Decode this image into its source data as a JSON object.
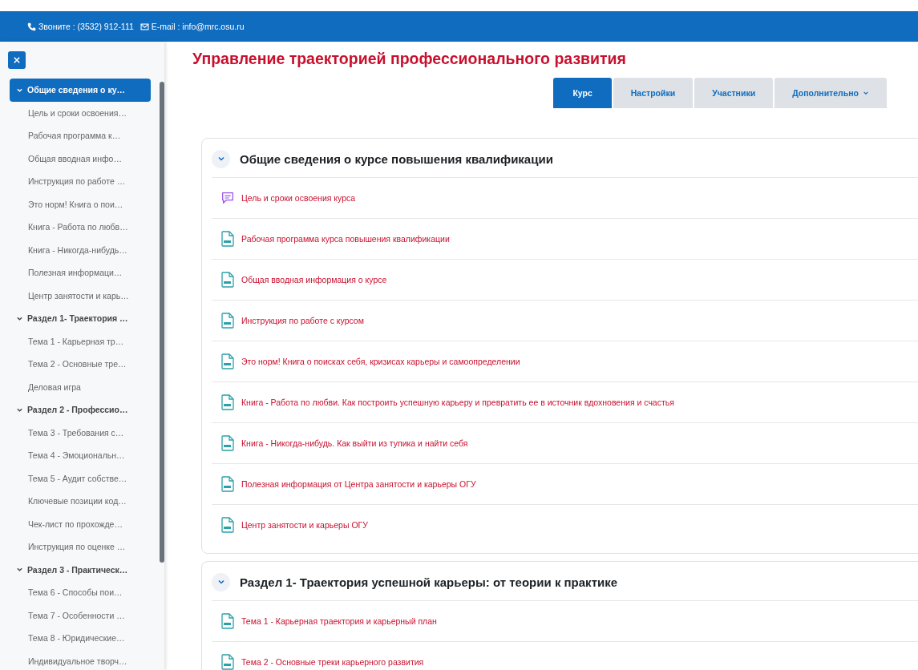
{
  "top_bar": {
    "phone": "Звоните : (3532) 912-111",
    "email": "E-mail : info@mrc.osu.ru"
  },
  "course_index": [
    {
      "title": "Общие сведения о ку…",
      "selected": true,
      "expanded": true,
      "children": [
        {
          "title": "Цель и сроки освоения…"
        },
        {
          "title": "Рабочая программа к…"
        },
        {
          "title": "Общая вводная инфо…"
        },
        {
          "title": "Инструкция по работе …"
        },
        {
          "title": "Это норм! Книга о пои…"
        },
        {
          "title": "Книга - Работа по любв…"
        },
        {
          "title": "Книга - Никогда-нибудь…"
        },
        {
          "title": "Полезная информаци…"
        },
        {
          "title": "Центр занятости и карь…"
        }
      ]
    },
    {
      "title": "Раздел 1- Траектория …",
      "selected": false,
      "expanded": true,
      "children": [
        {
          "title": "Тема 1 - Карьерная тр…"
        },
        {
          "title": "Тема 2 - Основные тре…"
        },
        {
          "title": "Деловая игра"
        }
      ]
    },
    {
      "title": "Раздел 2 - Профессио…",
      "selected": false,
      "expanded": true,
      "children": [
        {
          "title": "Тема 3 - Требования с…"
        },
        {
          "title": "Тема 4 - Эмоциональн…"
        },
        {
          "title": "Тема 5 - Аудит собстве…"
        },
        {
          "title": "Ключевые позиции код…"
        },
        {
          "title": "Чек-лист по прохожде…"
        },
        {
          "title": "Инструкция по оценке …"
        }
      ]
    },
    {
      "title": "Раздел 3 - Практическ…",
      "selected": false,
      "expanded": true,
      "children": [
        {
          "title": "Тема 6 - Способы пои…"
        },
        {
          "title": "Тема 7 - Особенности …"
        },
        {
          "title": "Тема 8 - Юридические…"
        },
        {
          "title": "Индивидуальное творч…"
        }
      ]
    }
  ],
  "page_title": "Управление траекторией профессионального развития",
  "tabs": [
    {
      "label": "Курс",
      "selected": true,
      "dropdown": false
    },
    {
      "label": "Настройки",
      "selected": false,
      "dropdown": false
    },
    {
      "label": "Участники",
      "selected": false,
      "dropdown": false
    },
    {
      "label": "Дополнительно",
      "selected": false,
      "dropdown": true
    }
  ],
  "sections": [
    {
      "title": "Общие сведения о курсе повышения квалификации",
      "expanded": true,
      "activities": [
        {
          "kind": "forum",
          "name": "Цель и сроки освоения курса"
        },
        {
          "kind": "file",
          "name": "Рабочая программа курса повышения квалификации"
        },
        {
          "kind": "file",
          "name": "Общая вводная информация о курсе"
        },
        {
          "kind": "file",
          "name": "Инструкция по работе с курсом"
        },
        {
          "kind": "file",
          "name": "Это норм! Книга о поисках себя, кризисах карьеры и самоопределении"
        },
        {
          "kind": "file",
          "name": "Книга - Работа по любви. Как построить успешную карьеру и превратить ее в источник вдохновения и счастья"
        },
        {
          "kind": "file",
          "name": "Книга - Никогда-нибудь. Как выйти из тупика и найти себя"
        },
        {
          "kind": "file",
          "name": "Полезная информация от Центра занятости и карьеры ОГУ"
        },
        {
          "kind": "file",
          "name": "Центр занятости и карьеры ОГУ"
        }
      ]
    },
    {
      "title": "Раздел 1- Траектория успешной карьеры: от теории к практике",
      "expanded": true,
      "activities": [
        {
          "kind": "file",
          "name": "Тема 1 - Карьерная траектория и карьерный план"
        },
        {
          "kind": "file",
          "name": "Тема 2 - Основные треки карьерного развития"
        }
      ]
    }
  ]
}
